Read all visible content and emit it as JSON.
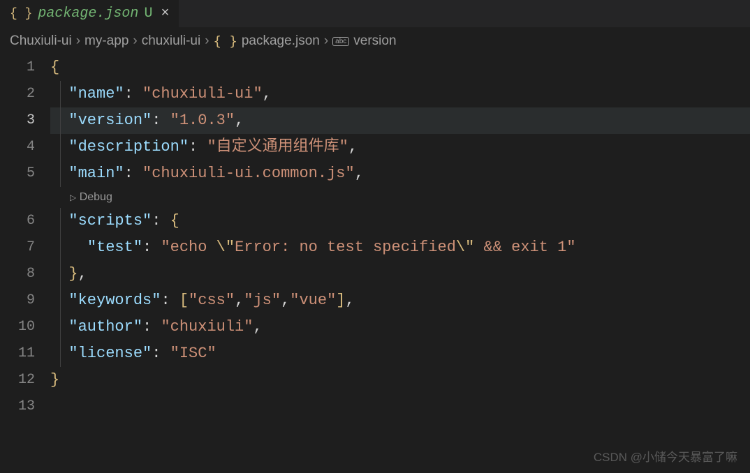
{
  "tab": {
    "filename": "package.json",
    "modified_marker": "U",
    "close_symbol": "×"
  },
  "breadcrumbs": {
    "sep": "›",
    "items": [
      "Chuxiuli-ui",
      "my-app",
      "chuxiuli-ui",
      "package.json",
      "version"
    ],
    "file_icon": "{ }",
    "abc_icon": "abc"
  },
  "codelens": {
    "debug_label": "Debug"
  },
  "gutter": {
    "lines": [
      "1",
      "2",
      "3",
      "4",
      "5",
      "6",
      "7",
      "8",
      "9",
      "10",
      "11",
      "12",
      "13"
    ],
    "active_line": "3"
  },
  "json_content": {
    "name_key": "\"name\"",
    "name_value": "\"chuxiuli-ui\"",
    "version_key": "\"version\"",
    "version_value": "\"1.0.3\"",
    "description_key": "\"description\"",
    "description_value": "\"自定义通用组件库\"",
    "main_key": "\"main\"",
    "main_value": "\"chuxiuli-ui.common.js\"",
    "scripts_key": "\"scripts\"",
    "test_key": "\"test\"",
    "test_value_p1": "\"echo ",
    "test_value_esc1": "\\\"",
    "test_value_p2": "Error: no test specified",
    "test_value_esc2": "\\\"",
    "test_value_p3": " && exit 1\"",
    "keywords_key": "\"keywords\"",
    "kw_css": "\"css\"",
    "kw_js": "\"js\"",
    "kw_vue": "\"vue\"",
    "author_key": "\"author\"",
    "author_value": "\"chuxiuli\"",
    "license_key": "\"license\"",
    "license_value": "\"ISC\"",
    "open_brace": "{",
    "close_brace": "}",
    "open_bracket": "[",
    "close_bracket": "]",
    "colon": ": ",
    "comma": ","
  },
  "watermark": "CSDN @小储今天暴富了嘛"
}
